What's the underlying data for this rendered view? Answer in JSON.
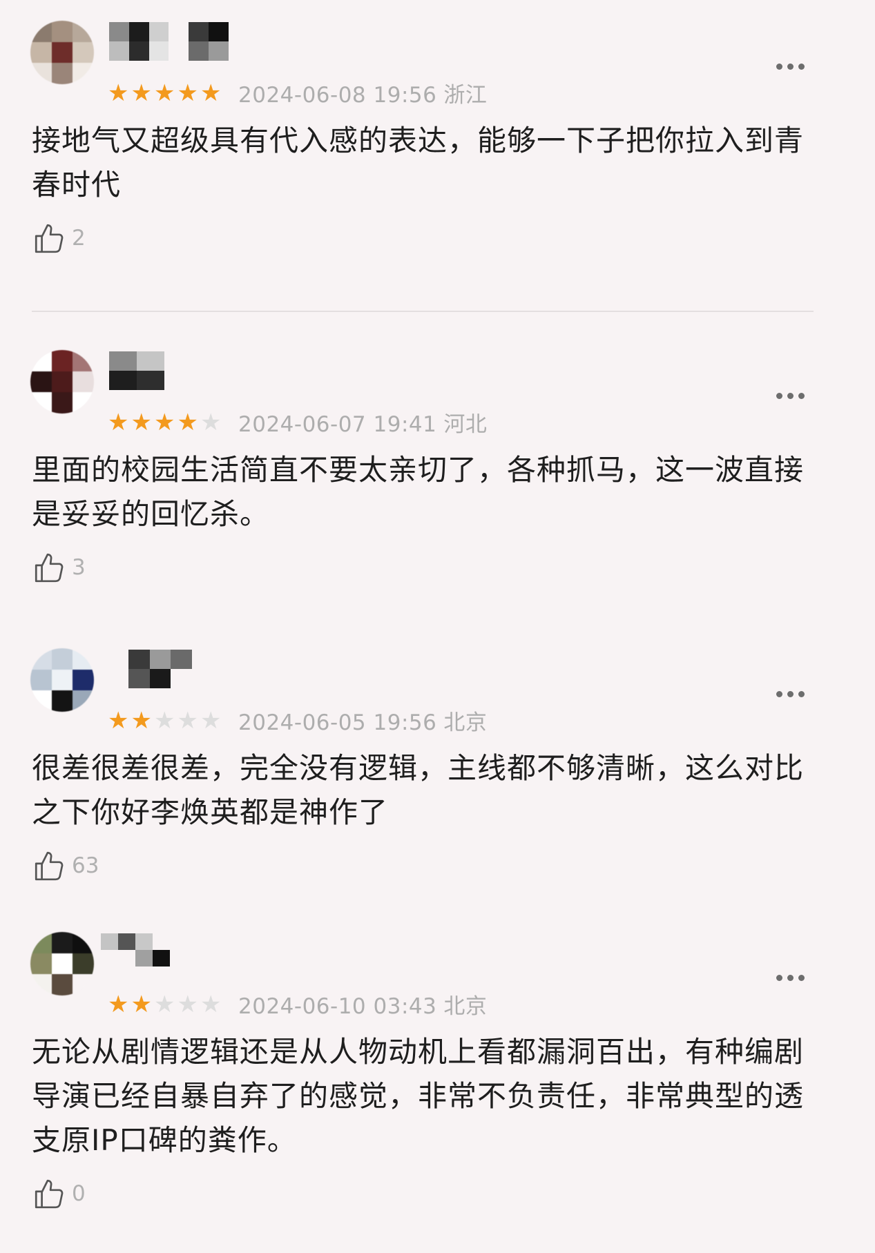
{
  "reviews": [
    {
      "rating": 5,
      "date": "2024-06-08 19:56",
      "region": "浙江",
      "content": "接地气又超级具有代入感的表达，能够一下子把你拉入到青春时代",
      "likes": "2"
    },
    {
      "rating": 4,
      "date": "2024-06-07 19:41",
      "region": "河北",
      "content": "里面的校园生活简直不要太亲切了，各种抓马，这一波直接是妥妥的回忆杀。",
      "likes": "3"
    },
    {
      "rating": 2,
      "date": "2024-06-05 19:56",
      "region": "北京",
      "content": "很差很差很差，完全没有逻辑，主线都不够清晰，这么对比之下你好李焕英都是神作了",
      "likes": "63"
    },
    {
      "rating": 2,
      "date": "2024-06-10 03:43",
      "region": "北京",
      "content": "无论从剧情逻辑还是从人物动机上看都漏洞百出，有种编剧导演已经自暴自弃了的感觉，非常不负责任，非常典型的透支原IP口碑的粪作。",
      "likes": "0"
    }
  ],
  "colors": {
    "star_filled": "#f39a1e",
    "star_empty": "#dddddd",
    "background": "#f8f3f4"
  },
  "icons": {
    "more": "more-dots-icon",
    "like": "thumbs-up-icon",
    "star": "star-icon"
  }
}
